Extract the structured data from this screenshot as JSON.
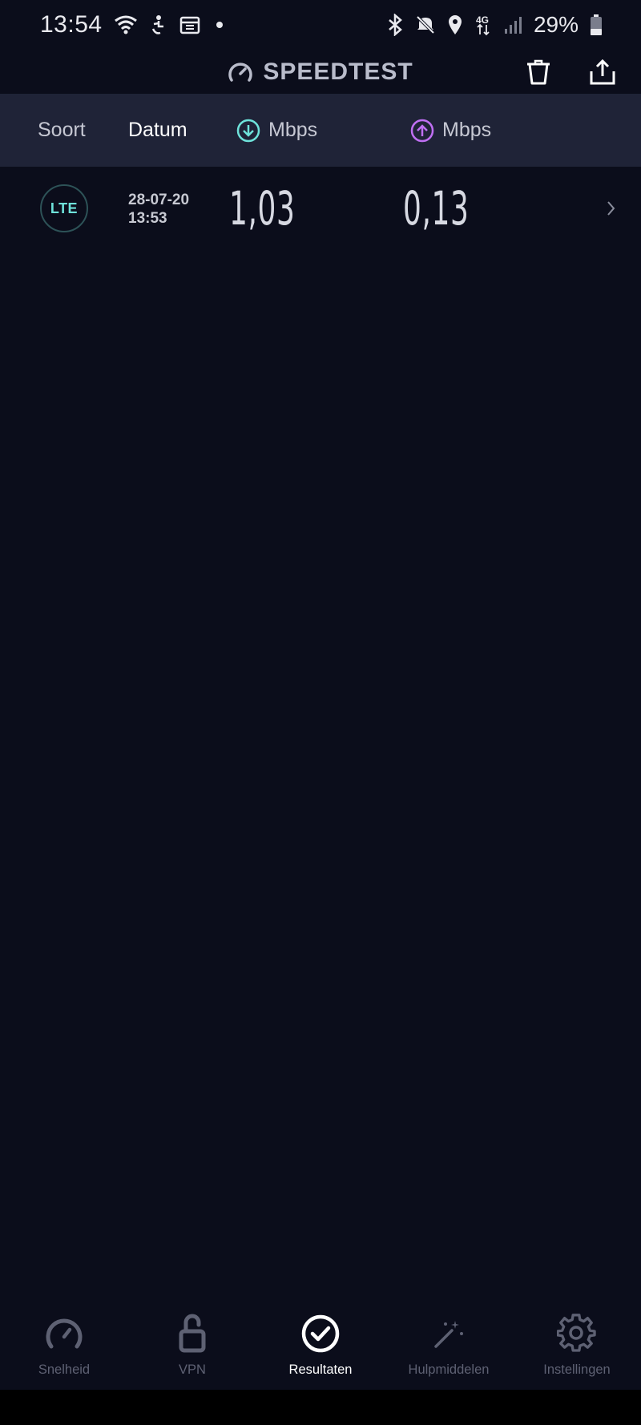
{
  "status_bar": {
    "time": "13:54",
    "battery": "29%",
    "icons": [
      "wifi-icon",
      "accessibility-icon",
      "calendar-icon",
      "dot-icon",
      "bluetooth-icon",
      "mute-icon",
      "location-icon",
      "4g-icon",
      "signal-icon",
      "battery-icon"
    ],
    "network_label": "4G"
  },
  "header": {
    "title": "SPEEDTEST",
    "actions": [
      "trash-icon",
      "share-icon"
    ]
  },
  "columns": {
    "sort": "Soort",
    "date": "Datum",
    "download": "Mbps",
    "upload": "Mbps"
  },
  "results": [
    {
      "type": "LTE",
      "date": "28-07-20",
      "time": "13:53",
      "download": "1,03",
      "upload": "0,13"
    }
  ],
  "nav": {
    "items": [
      {
        "label": "Snelheid",
        "icon": "speedometer-icon"
      },
      {
        "label": "VPN",
        "icon": "unlock-icon"
      },
      {
        "label": "Resultaten",
        "icon": "check-circle-icon"
      },
      {
        "label": "Hulpmiddelen",
        "icon": "magic-wand-icon"
      },
      {
        "label": "Instellingen",
        "icon": "gear-icon"
      }
    ],
    "active": "Resultaten"
  },
  "colors": {
    "background": "#0b0d1b",
    "column_bar": "#1f2337",
    "download_accent": "#6ee2da",
    "upload_accent": "#bf6ff2"
  }
}
